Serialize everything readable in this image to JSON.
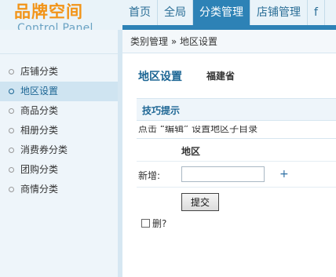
{
  "brand": {
    "logo_cn": "品牌空间",
    "logo_en": "Control Panel"
  },
  "nav": {
    "items": [
      {
        "label": "首页"
      },
      {
        "label": "全局"
      },
      {
        "label": "分类管理",
        "active": true
      },
      {
        "label": "店铺管理"
      },
      {
        "label": "f"
      }
    ]
  },
  "sidebar": {
    "items": [
      {
        "label": "店铺分类"
      },
      {
        "label": "地区设置",
        "active": true
      },
      {
        "label": "商品分类"
      },
      {
        "label": "相册分类"
      },
      {
        "label": "消费券分类"
      },
      {
        "label": "团购分类"
      },
      {
        "label": "商情分类"
      }
    ]
  },
  "main": {
    "breadcrumb": "类别管理 » 地区设置",
    "page_title": "地区设置",
    "region_name": "福建省",
    "tips_title": "技巧提示",
    "tips_text": "点击 “编辑” 设置地区子目录",
    "column_header": "地区",
    "add_label": "新增:",
    "add_input_value": "",
    "add_icon": "plus-icon",
    "submit_label": "提交",
    "delete_label": "删?"
  },
  "colors": {
    "logo": "#f29418",
    "accent": "#2d82b6",
    "link": "#1d6694",
    "sidebar_bg": "#eef5fa"
  }
}
